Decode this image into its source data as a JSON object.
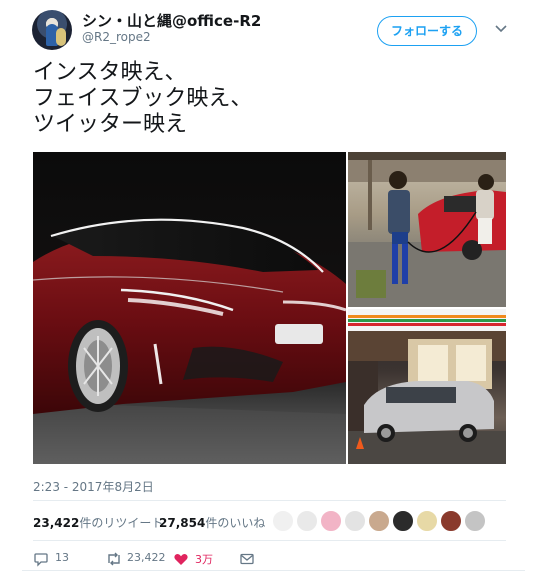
{
  "user": {
    "display_name": "シン・山と縄@office-R2",
    "handle": "@R2_rope2",
    "follow_label": "フォローする"
  },
  "tweet": {
    "lines": [
      "インスタ映え、",
      "フェイスブック映え、",
      "ツイッター映え"
    ],
    "timestamp": "2:23 - 2017年8月2日"
  },
  "stats": {
    "retweets_count": "23,422",
    "retweets_label": "件のリツイート",
    "likes_count": "27,854",
    "likes_label": "件のいいね"
  },
  "likers": {
    "colors": [
      "#f0f0f0",
      "#e9e9e9",
      "#f2b4c6",
      "#e3e3e3",
      "#c9a98e",
      "#2b2b2b",
      "#e7d9a6",
      "#8a3a2c",
      "#c4c4c4"
    ]
  },
  "actions": {
    "reply_count": "13",
    "retweet_count": "23,422",
    "like_count": "3万",
    "like_color": "#e0245e",
    "icons": [
      "reply-icon",
      "retweet-icon",
      "heart-icon",
      "envelope-icon"
    ]
  },
  "colors": {
    "accent": "#1da1f2",
    "text_primary": "#14171a",
    "text_secondary": "#657786"
  }
}
